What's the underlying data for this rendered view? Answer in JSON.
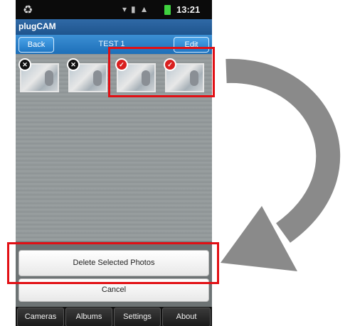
{
  "status_bar": {
    "time": "13:21"
  },
  "app": {
    "title": "plugCAM"
  },
  "nav": {
    "back_label": "Back",
    "title": "TEST 1",
    "edit_label": "Edit"
  },
  "photos": [
    {
      "selected": false
    },
    {
      "selected": false
    },
    {
      "selected": true
    },
    {
      "selected": true
    }
  ],
  "actions": {
    "delete_label": "Delete Selected Photos",
    "cancel_label": "Cancel"
  },
  "tabs": [
    {
      "label": "Cameras"
    },
    {
      "label": "Albums"
    },
    {
      "label": "Settings"
    },
    {
      "label": "About"
    }
  ],
  "colors": {
    "highlight": "#e20f14",
    "accent": "#1d6fb9",
    "arrow": "#8a8a8a"
  }
}
